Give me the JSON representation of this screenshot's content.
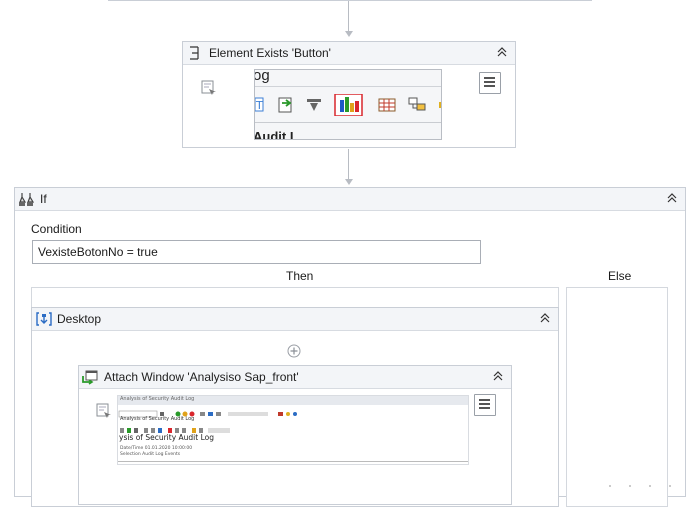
{
  "element_exists": {
    "title": "Element Exists 'Button'",
    "preview_text_top": "og",
    "preview_text_bottom": "Audit L"
  },
  "if_activity": {
    "title": "If",
    "condition_label": "Condition",
    "condition_value": "VexisteBotonNo = true",
    "then_label": "Then",
    "else_label": "Else"
  },
  "desktop": {
    "title": "Desktop"
  },
  "attach_window": {
    "title": "Attach Window 'Analysiso Sap_front'",
    "preview_line1": "Analysis of Security Audit Log",
    "preview_line2": "ysis of Security Audit Log",
    "preview_line3": "Date/Time  01.01.2020  10:00:00",
    "preview_line4": "Selection  Audit Log Events"
  },
  "icons": [
    "element-exists-icon",
    "collapse-icon",
    "menu-icon",
    "selector-icon",
    "if-icon",
    "desktop-icon",
    "add-activity-icon",
    "attach-window-icon"
  ]
}
